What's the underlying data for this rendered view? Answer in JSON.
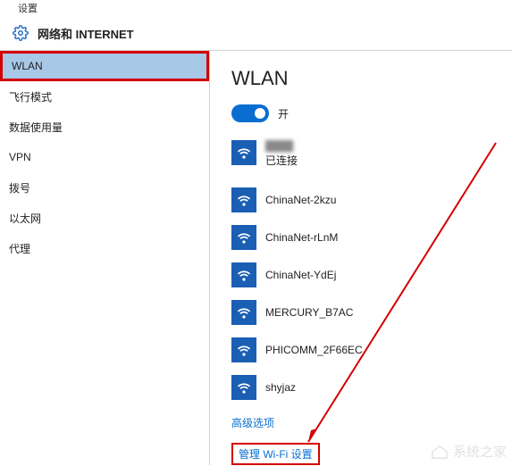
{
  "topbar": {
    "back_label": "设置"
  },
  "header": {
    "title": "网络和 INTERNET"
  },
  "sidebar": {
    "items": [
      {
        "label": "WLAN",
        "selected": true,
        "highlight": true
      },
      {
        "label": "飞行模式"
      },
      {
        "label": "数据使用量"
      },
      {
        "label": "VPN"
      },
      {
        "label": "拨号"
      },
      {
        "label": "以太网"
      },
      {
        "label": "代理"
      }
    ]
  },
  "pane": {
    "title": "WLAN",
    "toggle": {
      "state_label": "开",
      "on": true
    },
    "networks": [
      {
        "ssid_hidden": true,
        "status": "已连接"
      },
      {
        "ssid": "ChinaNet-2kzu"
      },
      {
        "ssid": "ChinaNet-rLnM"
      },
      {
        "ssid": "ChinaNet-YdEj"
      },
      {
        "ssid": "MERCURY_B7AC"
      },
      {
        "ssid": "PHICOMM_2F66EC"
      },
      {
        "ssid": "shyjaz"
      }
    ],
    "links": {
      "advanced": "高级选项",
      "manage_wifi": "管理 Wi-Fi 设置"
    }
  },
  "watermark": "系统之家",
  "colors": {
    "accent": "#0a6ed1",
    "highlight": "#d40000",
    "selected_bg": "#a8c8e8"
  }
}
